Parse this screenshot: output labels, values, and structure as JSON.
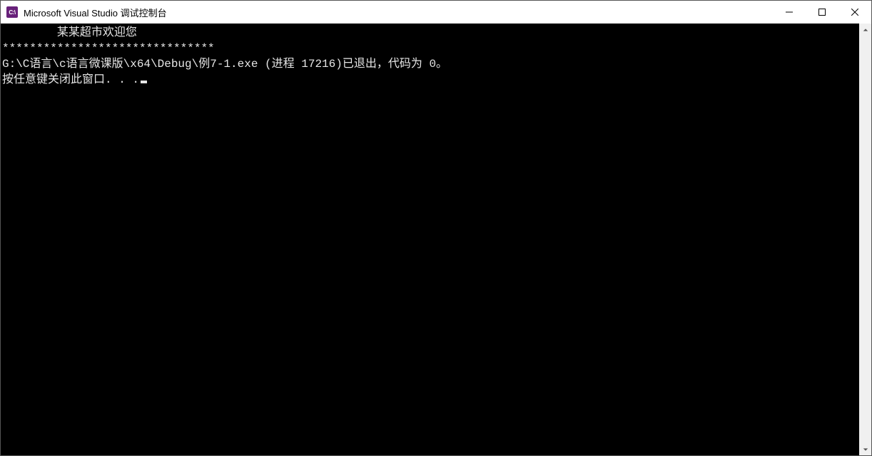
{
  "titlebar": {
    "icon_label": "C:\\",
    "title": "Microsoft Visual Studio 调试控制台"
  },
  "console": {
    "line1": "        某某超市欢迎您",
    "line2": "*******************************",
    "line3": "G:\\C语言\\c语言微课版\\x64\\Debug\\例7-1.exe (进程 17216)已退出，代码为 0。",
    "line4": "按任意键关闭此窗口. . ."
  }
}
